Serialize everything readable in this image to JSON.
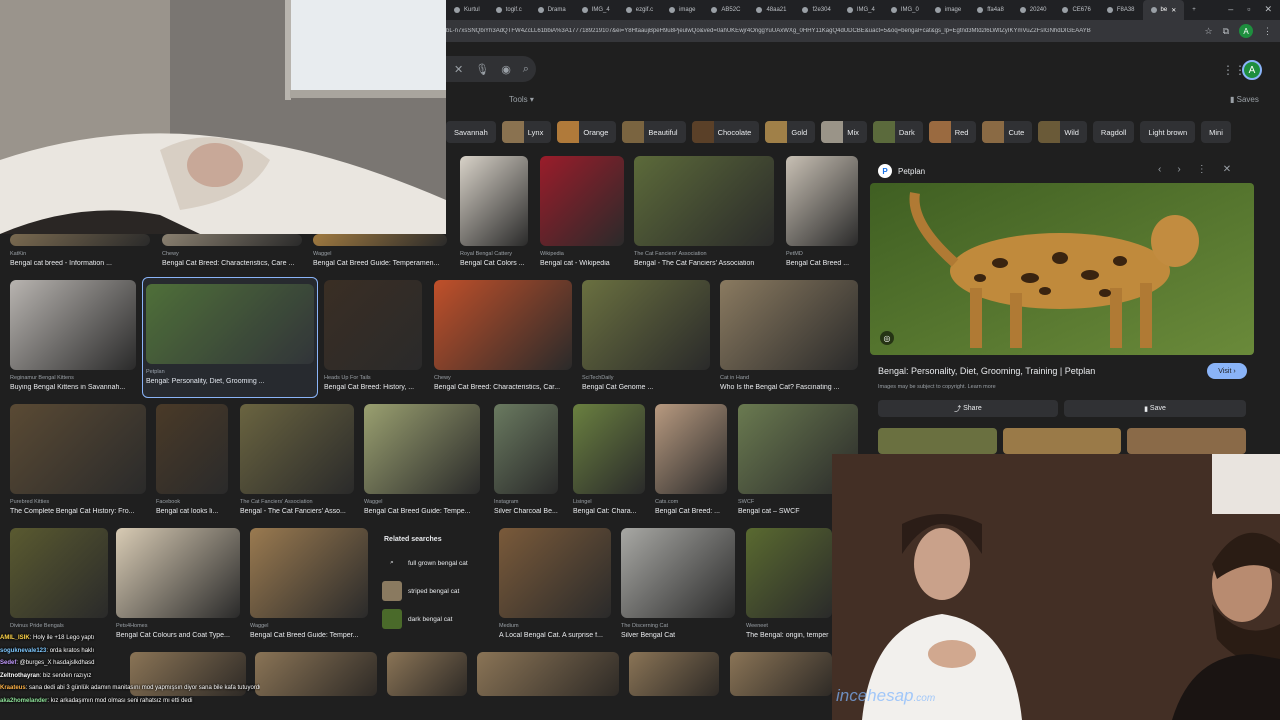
{
  "browser": {
    "tabs": [
      {
        "label": "Kurtul",
        "active": false
      },
      {
        "label": "togif.c",
        "active": false
      },
      {
        "label": "Drama",
        "active": false
      },
      {
        "label": "IMG_4",
        "active": false
      },
      {
        "label": "ezgif.c",
        "active": false
      },
      {
        "label": "image",
        "active": false
      },
      {
        "label": "AB52C",
        "active": false
      },
      {
        "label": "48aa21",
        "active": false
      },
      {
        "label": "f2e304",
        "active": false
      },
      {
        "label": "IMG_4",
        "active": false
      },
      {
        "label": "IMG_0",
        "active": false
      },
      {
        "label": "image",
        "active": false
      },
      {
        "label": "ffa4a8",
        "active": false
      },
      {
        "label": "20240",
        "active": false
      },
      {
        "label": "CE676",
        "active": false
      },
      {
        "label": "F8A38",
        "active": false
      },
      {
        "label": "be",
        "active": true
      }
    ],
    "url": "bL-n7xsSNQbiYh3AdQTFW4ZcLL61bbiA%3A1777189219107&ei=Y8HtaaujBpeH9u8PjeulwQo&ved=0ahUKEwjr4OnggYuUAxWXg_0HHY11KagQ4dUDCBE&uact=5&oq=bengal+cat&gs_lp=Egtnd3Mtd2l6LWltZyIKYmVuZ2FsIGNhdDIGEAAYB",
    "profile_letter": "A"
  },
  "google": {
    "tools_label": "Tools",
    "saves_label": "Saves",
    "avatar_letter": "A",
    "chips": [
      {
        "label": "Savannah",
        "thumb": false,
        "color": "#6a5a40"
      },
      {
        "label": "Lynx",
        "thumb": true,
        "color": "#8a7250"
      },
      {
        "label": "Orange",
        "thumb": true,
        "color": "#b07a3a"
      },
      {
        "label": "Beautiful",
        "thumb": true,
        "color": "#7a6440"
      },
      {
        "label": "Chocolate",
        "thumb": true,
        "color": "#5a4028"
      },
      {
        "label": "Gold",
        "thumb": true,
        "color": "#a08048"
      },
      {
        "label": "Mix",
        "thumb": true,
        "color": "#9a9488"
      },
      {
        "label": "Dark",
        "thumb": true,
        "color": "#5b6a3c"
      },
      {
        "label": "Red",
        "thumb": true,
        "color": "#9a6a40"
      },
      {
        "label": "Cute",
        "thumb": true,
        "color": "#8a6a44"
      },
      {
        "label": "Wild",
        "thumb": true,
        "color": "#6a5a38"
      },
      {
        "label": "Ragdoll",
        "thumb": false,
        "color": "#777"
      },
      {
        "label": "Light brown",
        "thumb": false,
        "color": "#777"
      },
      {
        "label": "Mini",
        "thumb": false,
        "color": "#777"
      }
    ],
    "results": [
      {
        "source": "Royal Bengal Cattery",
        "title": "Bengal Cat Colors ...",
        "color": "#d8d2c8"
      },
      {
        "source": "Wikipedia",
        "title": "Bengal cat - Wikipedia",
        "color": "#9a1c2a"
      },
      {
        "source": "The Cat Fanciers' Association",
        "title": "Bengal - The Cat Fanciers' Association",
        "color": "#5c6a3a"
      },
      {
        "source": "PetMD",
        "title": "Bengal Cat Breed ...",
        "color": "#c8c0b4"
      },
      {
        "source": "KatKin",
        "title": "Bengal cat breed - Information ...",
        "color": "#7a6a50"
      },
      {
        "source": "Chewy",
        "title": "Bengal Cat Breed: Characteristics, Care ...",
        "color": "#8a8070"
      },
      {
        "source": "Waggel",
        "title": "Bengal Cat Breed Guide: Temperamen...",
        "color": "#a07a40"
      },
      {
        "source": "Reginamur Bengal Kittens",
        "title": "Buying Bengal Kittens in Savannah...",
        "color": "#b8b4b0"
      },
      {
        "source": "Petplan",
        "title": "Bengal: Personality, Diet, Grooming ...",
        "color": "#4a6a2a"
      },
      {
        "source": "Heads Up For Tails",
        "title": "Bengal Cat Breed: History, ...",
        "color": "#3a2e24"
      },
      {
        "source": "Chewy",
        "title": "Bengal Cat Breed: Characteristics, Car...",
        "color": "#c0502a"
      },
      {
        "source": "SciTechDaily",
        "title": "Bengal Cat Genome ...",
        "color": "#6a7040"
      },
      {
        "source": "Cat in Hand",
        "title": "Who Is the Bengal Cat? Fascinating ...",
        "color": "#8a7a60"
      },
      {
        "source": "Purebred Kitties",
        "title": "The Complete Bengal Cat History: Fro...",
        "color": "#5a4a34"
      },
      {
        "source": "Facebook",
        "title": "Bengal cat looks li...",
        "color": "#4a3a28"
      },
      {
        "source": "The Cat Fanciers' Association",
        "title": "Bengal - The Cat Fanciers' Asso...",
        "color": "#6a6440"
      },
      {
        "source": "Waggel",
        "title": "Bengal Cat Breed Guide: Tempe...",
        "color": "#9aa070"
      },
      {
        "source": "Instagram",
        "title": "Silver Charcoal Be...",
        "color": "#6a7a60"
      },
      {
        "source": "Lisingel",
        "title": "Bengal Cat: Chara...",
        "color": "#6a8040"
      },
      {
        "source": "Cats.com",
        "title": "Bengal Cat Breed: ...",
        "color": "#b89a80"
      },
      {
        "source": "SWCF",
        "title": "Bengal cat – SWCF",
        "color": "#6a7a50"
      },
      {
        "source": "Divinus Pride Bengals",
        "title": "",
        "color": "#5a5a30"
      },
      {
        "source": "Pets4Homes",
        "title": "Bengal Cat Colours and Coat Type...",
        "color": "#d8cbb4"
      },
      {
        "source": "Waggel",
        "title": "Bengal Cat Breed Guide: Temper...",
        "color": "#9a7a50"
      },
      {
        "source": "Medium",
        "title": "A Local Bengal Cat. A surprise f...",
        "color": "#7a5a3a"
      },
      {
        "source": "The Discerning Cat",
        "title": "Silver Bengal Cat",
        "color": "#a8a8a4"
      },
      {
        "source": "Weeneet",
        "title": "The Bengal: origin, temper",
        "color": "#5a6a30"
      }
    ],
    "related": {
      "heading": "Related searches",
      "items": [
        "full grown bengal cat",
        "striped bengal cat",
        "dark bengal cat"
      ]
    },
    "panel": {
      "source": "Petplan",
      "title": "Bengal: Personality, Diet, Grooming, Training | Petplan",
      "visit_label": "Visit",
      "copyright": "Images may be subject to copyright. Learn more",
      "share_label": "Share",
      "save_label": "Save"
    }
  },
  "stream": {
    "watermark": "incehesap",
    "watermark_suffix": ".com",
    "chat": [
      {
        "user": "AMIL_ISIK",
        "text": ": Holy ile +18 Lego yaptı",
        "color": "#ffd54a"
      },
      {
        "user": "soguknevale123",
        "text": ": orda kratos haklı",
        "color": "#7ec8ff"
      },
      {
        "user": "Sedef",
        "text": ": @burges_X hasdajslkdhasd",
        "color": "#c39bff"
      },
      {
        "user": "Zeltnothayran",
        "text": ": biz senden razıyız",
        "color": "#ffffff"
      },
      {
        "user": "Kraateus",
        "text": ": sana dedi abi 3 günlük adamın manitasını mod yapmışsın diyor sana bile kafa tutuyordu",
        "color": "#ffb347"
      },
      {
        "user": "aka2homelander",
        "text": ": kız arkadaşımın mod olması seni rahatsız mı etti dedi",
        "color": "#8fe39a"
      }
    ]
  }
}
